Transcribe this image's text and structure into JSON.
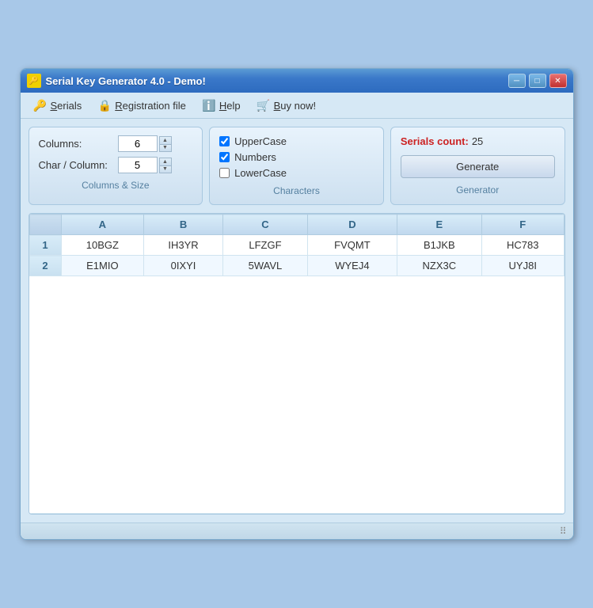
{
  "window": {
    "title": "Serial Key Generator 4.0 - Demo!",
    "title_icon": "🔑",
    "min_btn": "─",
    "max_btn": "□",
    "close_btn": "✕"
  },
  "menu": {
    "items": [
      {
        "id": "serials",
        "icon": "🔑",
        "label": "Serials",
        "underline_index": 0
      },
      {
        "id": "registration",
        "icon": "🔒",
        "label": "Registration file",
        "underline_index": 0
      },
      {
        "id": "help",
        "icon": "ℹ️",
        "label": "Help",
        "underline_index": 0
      },
      {
        "id": "buy",
        "icon": "🛒",
        "label": "Buy now!",
        "underline_index": 0
      }
    ]
  },
  "columns_panel": {
    "label": "Columns & Size",
    "columns_label": "Columns:",
    "columns_value": "6",
    "chars_label": "Char / Column:",
    "chars_value": "5"
  },
  "characters_panel": {
    "label": "Characters",
    "uppercase_label": "UpperCase",
    "uppercase_checked": true,
    "numbers_label": "Numbers",
    "numbers_checked": true,
    "lowercase_label": "LowerCase",
    "lowercase_checked": false
  },
  "generator_panel": {
    "label": "Generator",
    "serials_count_label": "Serials count:",
    "serials_count_value": "25",
    "generate_btn_label": "Generate"
  },
  "table": {
    "headers": [
      "",
      "A",
      "B",
      "C",
      "D",
      "E",
      "F"
    ],
    "rows": [
      {
        "num": "1",
        "cols": [
          "10BGZ",
          "IH3YR",
          "LFZGF",
          "FVQMT",
          "B1JKB",
          "HC783"
        ]
      },
      {
        "num": "2",
        "cols": [
          "E1MIO",
          "0IXYI",
          "5WAVL",
          "WYEJ4",
          "NZX3C",
          "UYJ8I"
        ]
      }
    ]
  }
}
